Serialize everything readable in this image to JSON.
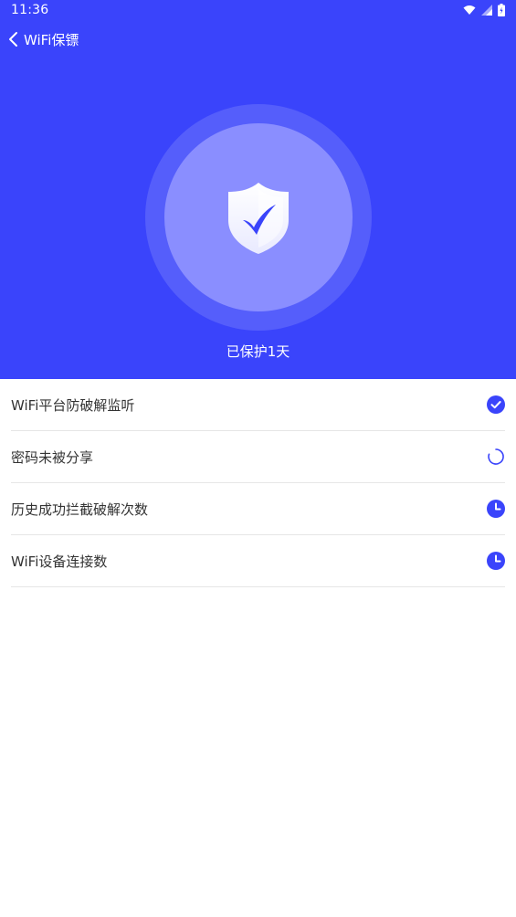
{
  "status_bar": {
    "time": "11:36",
    "icons": [
      "wifi-icon",
      "signal-icon",
      "battery-icon"
    ]
  },
  "topbar": {
    "back_icon": "chevron-left-icon",
    "title": "WiFi保镖"
  },
  "hero": {
    "icon": "shield-check-icon",
    "status_text": "已保护1天"
  },
  "checklist": {
    "items": [
      {
        "label": "WiFi平台防破解监听",
        "status_icon": "check-circle-icon"
      },
      {
        "label": "密码未被分享",
        "status_icon": "loading-spinner-icon"
      },
      {
        "label": "历史成功拦截破解次数",
        "status_icon": "clock-icon"
      },
      {
        "label": "WiFi设备连接数",
        "status_icon": "clock-icon"
      }
    ]
  },
  "colors": {
    "primary": "#3a44fb",
    "disc": "#8a8eff",
    "text": "#333333",
    "divider": "#e6e6e6"
  }
}
